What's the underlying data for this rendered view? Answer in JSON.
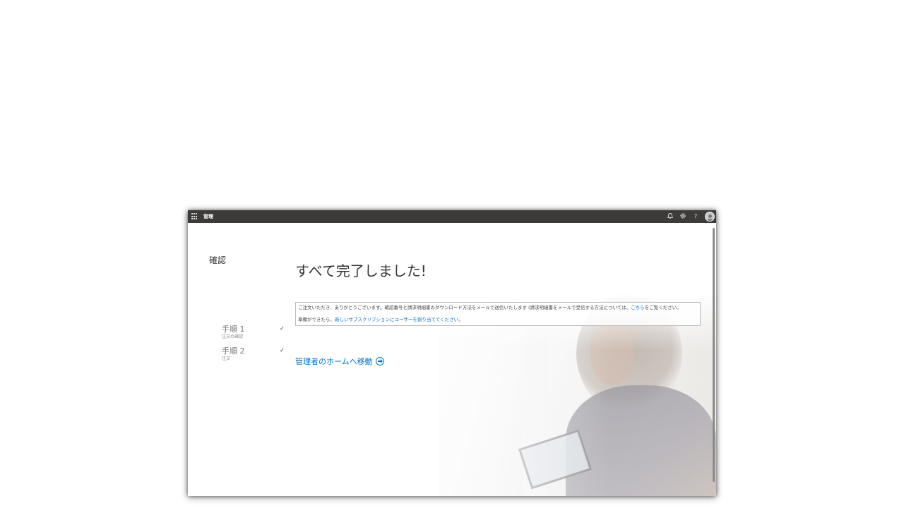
{
  "topbar": {
    "app_title": "管理",
    "help_glyph": "?"
  },
  "icons": {
    "launcher": "app-launcher-icon",
    "notifications": "bell-icon",
    "settings": "gear-icon",
    "help": "help-icon",
    "avatar": "avatar-icon",
    "go": "arrow-right-circle-icon",
    "check": "checkmark-icon"
  },
  "sidebar": {
    "title": "確認",
    "steps": [
      {
        "label": "手順 1",
        "sublabel": "注文の確認",
        "status": "complete",
        "check": "✓"
      },
      {
        "label": "手順 2",
        "sublabel": "注文",
        "status": "complete",
        "check": "✓"
      }
    ]
  },
  "main": {
    "headline": "すべて完了しました!",
    "info": {
      "line1_text": "ご注文いただき、ありがとうございます。確認番号と請求明細書のダウンロード方法をメールで送信いたします (請求明細書をメールで受信する方法については、",
      "line1_link": "こちら",
      "line1_suffix": "をご覧ください。",
      "line2_text": "準備ができたら、",
      "line2_link": "新しいサブスクリプションにユーザーを割り当ててください",
      "line2_suffix": "。"
    },
    "home_link": "管理者のホームへ移動"
  },
  "colors": {
    "topbar_bg": "#3c3b39",
    "link": "#0072c6",
    "text": "#333333"
  }
}
